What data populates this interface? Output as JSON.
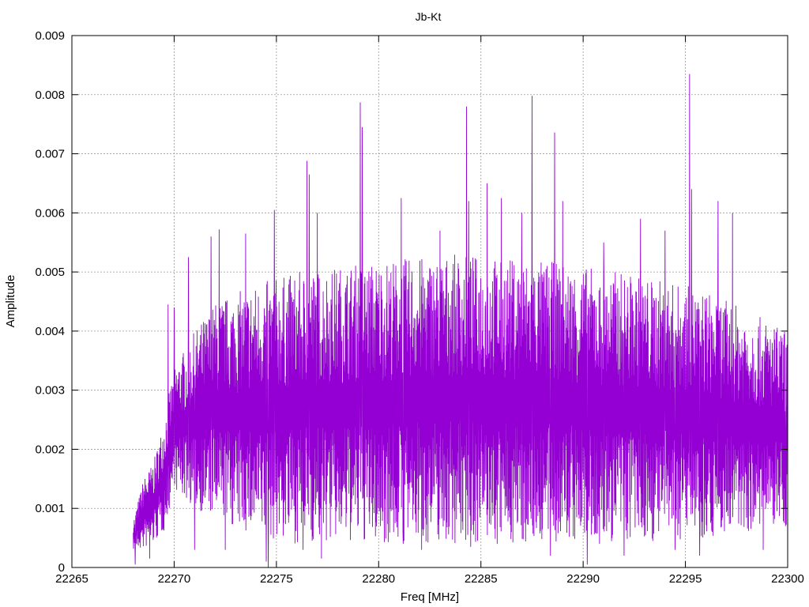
{
  "chart_data": {
    "type": "line",
    "title": "Jb-Kt",
    "xlabel": "Freq [MHz]",
    "ylabel": "Amplitude",
    "xlim": [
      22265,
      22300
    ],
    "ylim": [
      0,
      0.009
    ],
    "x_ticks": [
      "22265",
      "22270",
      "22275",
      "22280",
      "22285",
      "22290",
      "22295",
      "22300"
    ],
    "y_ticks": [
      "0",
      "0.001",
      "0.002",
      "0.003",
      "0.004",
      "0.005",
      "0.006",
      "0.007",
      "0.008",
      "0.009"
    ],
    "grid": true,
    "legend": "none",
    "line_color": "#9400d3",
    "series": [
      {
        "x_start": 22268.0,
        "x_end": 22300.0,
        "envelope": [
          [
            22268.0,
            0.0003,
            0.0008
          ],
          [
            22268.5,
            0.0003,
            0.0015
          ],
          [
            22269.0,
            0.0004,
            0.0018
          ],
          [
            22269.5,
            0.0006,
            0.0025
          ],
          [
            22270.0,
            0.0013,
            0.0034
          ],
          [
            22271.0,
            0.001,
            0.004
          ],
          [
            22272.0,
            0.0008,
            0.0045
          ],
          [
            22274.0,
            0.0005,
            0.0048
          ],
          [
            22276.0,
            0.0004,
            0.005
          ],
          [
            22280.0,
            0.0004,
            0.0052
          ],
          [
            22284.0,
            0.0004,
            0.0053
          ],
          [
            22288.0,
            0.0004,
            0.0052
          ],
          [
            22292.0,
            0.0004,
            0.005
          ],
          [
            22296.0,
            0.0005,
            0.0047
          ],
          [
            22300.0,
            0.0007,
            0.004
          ]
        ],
        "peaks": [
          [
            22269.7,
            0.00445
          ],
          [
            22270.0,
            0.0044
          ],
          [
            22270.7,
            0.00525
          ],
          [
            22271.8,
            0.0056
          ],
          [
            22272.2,
            0.00572
          ],
          [
            22273.5,
            0.00565
          ],
          [
            22274.9,
            0.00605
          ],
          [
            22276.3,
            0.0066
          ],
          [
            22276.5,
            0.00688
          ],
          [
            22276.6,
            0.00665
          ],
          [
            22277.0,
            0.006
          ],
          [
            22279.1,
            0.00787
          ],
          [
            22279.2,
            0.00745
          ],
          [
            22281.1,
            0.00625
          ],
          [
            22283.0,
            0.0057
          ],
          [
            22284.3,
            0.0078
          ],
          [
            22284.4,
            0.0062
          ],
          [
            22285.3,
            0.0065
          ],
          [
            22286.0,
            0.00625
          ],
          [
            22287.0,
            0.006
          ],
          [
            22287.5,
            0.00798
          ],
          [
            22288.6,
            0.00736
          ],
          [
            22289.0,
            0.0062
          ],
          [
            22291.0,
            0.0055
          ],
          [
            22292.8,
            0.0059
          ],
          [
            22294.0,
            0.0057
          ],
          [
            22295.2,
            0.00835
          ],
          [
            22295.3,
            0.0064
          ],
          [
            22296.6,
            0.0062
          ],
          [
            22297.3,
            0.006
          ]
        ],
        "dips": [
          [
            22268.1,
            5e-05
          ],
          [
            22268.8,
            0.00015
          ],
          [
            22271.0,
            0.0003
          ],
          [
            22272.5,
            0.0003
          ],
          [
            22274.5,
            0.0001
          ],
          [
            22274.6,
            0.0
          ],
          [
            22276.3,
            0.0003
          ],
          [
            22277.2,
            0.00015
          ],
          [
            22281.2,
            0.0004
          ],
          [
            22282.1,
            0.0003
          ],
          [
            22284.5,
            0.00035
          ],
          [
            22285.8,
            0.0004
          ],
          [
            22288.4,
            0.0002
          ],
          [
            22290.2,
            5e-05
          ],
          [
            22290.8,
            0.0004
          ],
          [
            22292.0,
            0.0002
          ],
          [
            22294.5,
            0.0003
          ],
          [
            22295.7,
            0.0002
          ],
          [
            22298.8,
            0.0003
          ],
          [
            22299.9,
            0.0007
          ]
        ]
      }
    ]
  }
}
